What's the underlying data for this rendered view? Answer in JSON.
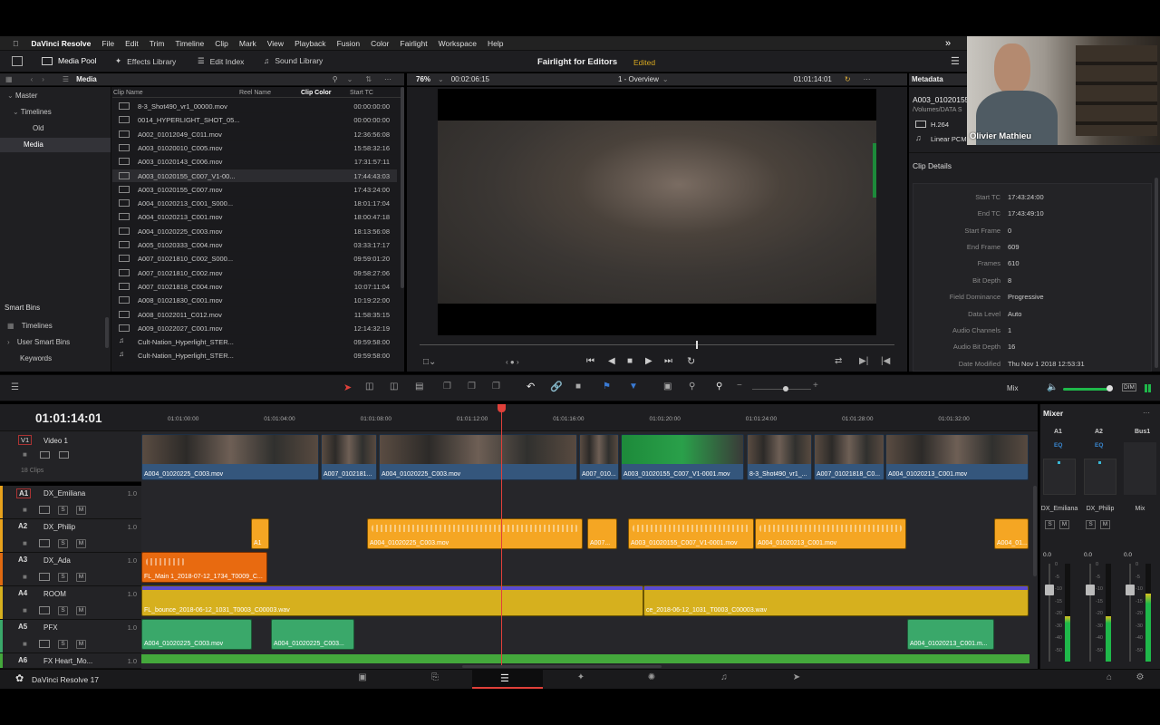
{
  "menubar": {
    "app": "DaVinci Resolve",
    "items": [
      "File",
      "Edit",
      "Trim",
      "Timeline",
      "Clip",
      "Mark",
      "View",
      "Playback",
      "Fusion",
      "Color",
      "Fairlight",
      "Workspace",
      "Help"
    ]
  },
  "toolbar": {
    "media_pool": "Media Pool",
    "effects_library": "Effects Library",
    "edit_index": "Edit Index",
    "sound_library": "Sound Library",
    "project_title": "Fairlight for Editors",
    "status": "Edited"
  },
  "media": {
    "header": "Media",
    "cols": [
      "Clip Name",
      "Reel Name",
      "Clip Color",
      "Start TC"
    ],
    "tree": [
      "Master",
      "Timelines",
      "Old",
      "Media"
    ],
    "smart_bins_title": "Smart Bins",
    "smart_bins": [
      "Timelines",
      "User Smart Bins",
      "Keywords"
    ],
    "clips": [
      {
        "name": "8-3_Shot490_vr1_00000.mov",
        "tc": "00:00:00:00"
      },
      {
        "name": "0014_HYPERLIGHT_SHOT_05...",
        "tc": "00:00:00:00"
      },
      {
        "name": "A002_01012049_C011.mov",
        "tc": "12:36:56:08"
      },
      {
        "name": "A003_01020010_C005.mov",
        "tc": "15:58:32:16"
      },
      {
        "name": "A003_01020143_C006.mov",
        "tc": "17:31:57:11"
      },
      {
        "name": "A003_01020155_C007_V1-00...",
        "tc": "17:44:43:03"
      },
      {
        "name": "A003_01020155_C007.mov",
        "tc": "17:43:24:00"
      },
      {
        "name": "A004_01020213_C001_S000...",
        "tc": "18:01:17:04"
      },
      {
        "name": "A004_01020213_C001.mov",
        "tc": "18:00:47:18"
      },
      {
        "name": "A004_01020225_C003.mov",
        "tc": "18:13:56:08"
      },
      {
        "name": "A005_01020333_C004.mov",
        "tc": "03:33:17:17"
      },
      {
        "name": "A007_01021810_C002_S000...",
        "tc": "09:59:01:20"
      },
      {
        "name": "A007_01021810_C002.mov",
        "tc": "09:58:27:06"
      },
      {
        "name": "A007_01021818_C004.mov",
        "tc": "10:07:11:04"
      },
      {
        "name": "A008_01021830_C001.mov",
        "tc": "10:19:22:00"
      },
      {
        "name": "A008_01022011_C012.mov",
        "tc": "11:58:35:15"
      },
      {
        "name": "A009_01022027_C001.mov",
        "tc": "12:14:32:19"
      },
      {
        "name": "Cult-Nation_Hyperlight_STER...",
        "tc": "09:59:58:00"
      },
      {
        "name": "Cult-Nation_Hyperlight_STER...",
        "tc": "09:59:58:00"
      }
    ]
  },
  "viewer": {
    "zoom": "76%",
    "duration": "00:02:06:15",
    "timeline_name": "1 - Overview",
    "timecode": "01:01:14:01"
  },
  "metadata": {
    "header": "Metadata",
    "clip_name": "A003_01020155",
    "path": "/Volumes/DATA S",
    "video_codec": "H.264",
    "audio_codec": "Linear PCM",
    "section": "Clip Details",
    "rows": [
      {
        "k": "Start TC",
        "v": "17:43:24:00"
      },
      {
        "k": "End TC",
        "v": "17:43:49:10"
      },
      {
        "k": "Start Frame",
        "v": "0"
      },
      {
        "k": "End Frame",
        "v": "609"
      },
      {
        "k": "Frames",
        "v": "610"
      },
      {
        "k": "Bit Depth",
        "v": "8"
      },
      {
        "k": "Field Dominance",
        "v": "Progressive"
      },
      {
        "k": "Data Level",
        "v": "Auto"
      },
      {
        "k": "Audio Channels",
        "v": "1"
      },
      {
        "k": "Audio Bit Depth",
        "v": "16"
      },
      {
        "k": "Date Modified",
        "v": "Thu Nov 1 2018 12:53:31"
      }
    ]
  },
  "webcam": {
    "name": "Olivier Mathieu"
  },
  "timeline": {
    "timecode": "01:01:14:01",
    "mix_label": "Mix",
    "dim": "DIM",
    "ruler": [
      "01:01:00:00",
      "01:01:04:00",
      "01:01:08:00",
      "01:01:12:00",
      "01:01:16:00",
      "01:01:20:00",
      "01:01:24:00",
      "01:01:28:00",
      "01:01:32:00"
    ],
    "tracks": [
      {
        "id": "V1",
        "name": "Video 1",
        "sub": "18 Clips"
      },
      {
        "id": "A1",
        "name": "DX_Emiliana",
        "vol": "1.0"
      },
      {
        "id": "A2",
        "name": "DX_Philip",
        "vol": "1.0"
      },
      {
        "id": "A3",
        "name": "DX_Ada",
        "vol": "1.0"
      },
      {
        "id": "A4",
        "name": "ROOM",
        "vol": "1.0"
      },
      {
        "id": "A5",
        "name": "PFX",
        "vol": "1.0"
      },
      {
        "id": "A6",
        "name": "FX Heart_Mo...",
        "vol": "1.0"
      }
    ],
    "video_clips": [
      "A004_01020225_C003.mov",
      "A007_0102181...",
      "A004_01020225_C003.mov",
      "A007_010...",
      "A003_01020155_C007_V1-0001.mov",
      "8-3_Shot490_vr1_...",
      "A007_01021818_C0...",
      "A004_01020213_C001.mov"
    ],
    "a2_clips": [
      "A1",
      "A004_01020225_C003.mov",
      "A007...",
      "A003_01020155_C007_V1-0001.mov",
      "A004_01020213_C001.mov",
      "A004_01..."
    ],
    "a3_clip": "FL_Main 1_2018-07-12_1734_T0009_C...",
    "a4_clips": [
      "FL_bounce_2018-06-12_1031_T0003_C00003.wav",
      "ce_2018-06-12_1031_T0003_C00003.wav"
    ],
    "a5_clips": [
      "A004_01020225_C003.mov",
      "A004_01020225_C003...",
      "A004_01020213_C001.m..."
    ]
  },
  "mixer": {
    "title": "Mixer",
    "channels": [
      "A1",
      "A2",
      "Bus1"
    ],
    "eq": "EQ",
    "names": [
      "DX_Emiliana",
      "DX_Philip",
      "Mix"
    ],
    "s": "S",
    "m": "M",
    "gain": "0.0",
    "scale": [
      "0",
      "-5",
      "-10",
      "-15",
      "-20",
      "-30",
      "-40",
      "-50"
    ]
  },
  "status": {
    "app": "DaVinci Resolve 17"
  },
  "buttons": {
    "solo": "S",
    "mute": "M"
  }
}
